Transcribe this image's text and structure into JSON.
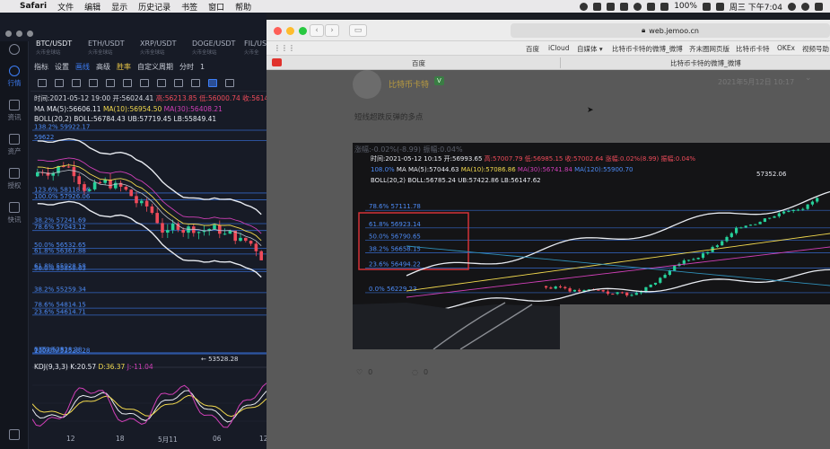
{
  "menubar": {
    "app_name": "Safari",
    "items": [
      "文件",
      "编辑",
      "显示",
      "历史记录",
      "书签",
      "窗口",
      "帮助"
    ],
    "battery": "100%",
    "datetime": "周三 下午7:04"
  },
  "trading_app": {
    "sidebar": [
      {
        "label": "行情",
        "icon": "chart-icon",
        "active": true
      },
      {
        "label": "资讯",
        "icon": "news-icon",
        "active": false
      },
      {
        "label": "资产",
        "icon": "wallet-icon",
        "active": false
      },
      {
        "label": "授权",
        "icon": "key-icon",
        "active": false
      },
      {
        "label": "快讯",
        "icon": "flash-icon",
        "active": false
      }
    ],
    "tabs": [
      {
        "pair": "BTC/USDT",
        "exchange": "火币全球站",
        "active": true
      },
      {
        "pair": "ETH/USDT",
        "exchange": "火币全球站",
        "active": false
      },
      {
        "pair": "XRP/USDT",
        "exchange": "火币全球站",
        "active": false
      },
      {
        "pair": "DOGE/USDT",
        "exchange": "火币全球站",
        "active": false
      },
      {
        "pair": "FIL/US",
        "exchange": "火币全",
        "active": false
      }
    ],
    "toolbar": {
      "indicator": "指标",
      "settings": "设置",
      "draw": "画线",
      "advanced": "高级",
      "winrate": "胜率",
      "custom_period": "自定义周期",
      "timeframe": "分时",
      "timeframe_extra": "1"
    },
    "ohlc": {
      "time_label": "时间:2021-05-12 19:00",
      "open": "开:56024.41",
      "high": "高:56213.85",
      "low": "低:56000.74",
      "close": "收:56149.7"
    },
    "ma_line": {
      "label": "MA",
      "ma5": "MA(5):56606.11",
      "ma10": "MA(10):56954.50",
      "ma30": "MA(30):56408.21"
    },
    "boll_line": {
      "label": "BOLL(20,2)",
      "values": "BOLL:56784.43 UB:57719.45 LB:55849.41"
    },
    "price_levels": [
      {
        "text": "138.2% 59922.17",
        "value": 59922.17
      },
      {
        "text": "59622",
        "value": 59622
      },
      {
        "text": "123.6% 58118.96",
        "value": 58118.96
      },
      {
        "text": "100.0% 57926.06",
        "value": 57926.06
      },
      {
        "text": "38.2% 57241.69",
        "value": 57241.69
      },
      {
        "text": "78.6% 57043.12",
        "value": 57043.12
      },
      {
        "text": "50.0% 56532.65",
        "value": 56532.65
      },
      {
        "text": "61.8% 56367.88",
        "value": 56367.88
      },
      {
        "text": "61.8% 55928.58",
        "value": 55928.58
      },
      {
        "text": "50.0% 55858.63",
        "value": 55858.63
      },
      {
        "text": "38.2% 55259.34",
        "value": 55259.34
      },
      {
        "text": "78.6% 54814.15",
        "value": 54814.15
      },
      {
        "text": "23.6% 54614.71",
        "value": 54614.71
      },
      {
        "text": "0.0% 53528.28",
        "value": 53528.28
      },
      {
        "text": "100.0% 53528.28",
        "value": 53500
      },
      {
        "text": "53528.28",
        "value": 53528.28
      }
    ],
    "kdj_line": {
      "label": "KDJ(9,3,3)",
      "k": "K:20.57",
      "d": "D:36.37",
      "j": "J:-11.04"
    },
    "x_axis": [
      "12",
      "18",
      "5月11",
      "06",
      "12"
    ],
    "colors": {
      "up": "#26d19a",
      "down": "#ef4b5a",
      "accent": "#3d7ef6"
    }
  },
  "safari": {
    "address": "web.jemoo.cn",
    "favorites": [
      "百度",
      "iCloud",
      "自媒体 ▾",
      "比特币卡特的微博_微博",
      "齐末圈网页版",
      "比特币卡特",
      "OKEx",
      "视频号助"
    ],
    "tabs": [
      "百度",
      "比特币卡特的微博_微博"
    ],
    "post": {
      "username": "比特币卡特",
      "badge": "V",
      "date": "2021年5月12日 10:17",
      "text": "短线超跌反弹的多点",
      "likes": "0",
      "comments": "0"
    },
    "image": {
      "header_partial": "涨幅:-0.02%(-8.99)   振幅:0.04%",
      "ohlc": {
        "time_label": "时间:2021-05-12 10:15",
        "open": "开:56993.65",
        "high": "高:57007.79",
        "low": "低:56985.15",
        "close": "收:57002.64",
        "change": "涨幅:0.02%(8.99)",
        "amplitude": "振幅:0.04%"
      },
      "ma_line": {
        "prefix": "108.0%",
        "label": "MA",
        "ma5": "MA(5):57044.63",
        "ma10": "MA(10):57086.86",
        "ma30": "MA(30):56741.84",
        "ma120": "MA(120):55900.70"
      },
      "boll_line": {
        "label": "BOLL(20,2)",
        "values": "BOLL:56785.24 UB:57422.86 LB:56147.62"
      },
      "levels": [
        {
          "text": "78.6% 57111.78",
          "value": 57111.78
        },
        {
          "text": "61.8% 56923.14",
          "value": 56923.14
        },
        {
          "text": "50.0% 56790.65",
          "value": 56790.65
        },
        {
          "text": "38.2% 56658.15",
          "value": 56658.15
        },
        {
          "text": "23.6% 56494.22",
          "value": 56494.22
        },
        {
          "text": "0.0% 56229.23",
          "value": 56229.23
        }
      ],
      "peak_label": "57352.06",
      "highlight_color": "#e0343a"
    }
  }
}
